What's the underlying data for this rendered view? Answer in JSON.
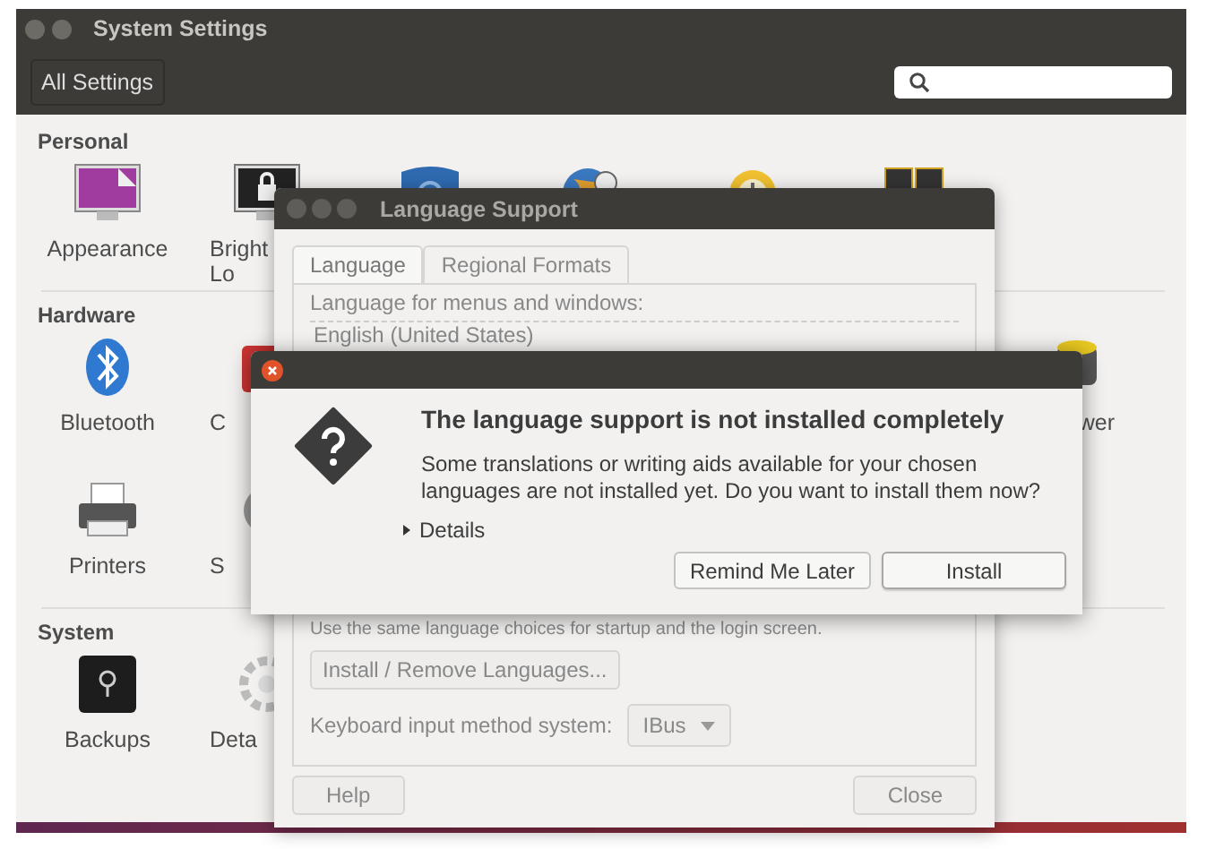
{
  "settings_window": {
    "title": "System Settings",
    "all_settings_button": "All Settings"
  },
  "sections": [
    {
      "title": "Personal",
      "items": [
        {
          "kind": "full",
          "lines": [
            "Appearance"
          ]
        },
        {
          "kind": "cut_right",
          "lines": [
            "Bright",
            "Lo"
          ]
        },
        {
          "kind": "icon_only"
        },
        {
          "kind": "icon_only"
        },
        {
          "kind": "icon_only"
        },
        {
          "kind": "icon_only"
        }
      ]
    },
    {
      "title": "Hardware",
      "items": [
        {
          "kind": "full",
          "lines": [
            "Bluetooth"
          ]
        },
        {
          "kind": "cut_right",
          "lines": [
            "C"
          ]
        },
        {
          "kind": "cut_left",
          "lines": [
            "wer"
          ]
        },
        {
          "kind": "full",
          "lines": [
            "Printers"
          ]
        },
        {
          "kind": "cut_right",
          "lines": [
            "S"
          ]
        }
      ]
    },
    {
      "title": "System",
      "items": [
        {
          "kind": "full",
          "lines": [
            "Backups"
          ]
        },
        {
          "kind": "cut_right",
          "lines": [
            "Deta"
          ]
        }
      ]
    }
  ],
  "language_support": {
    "title": "Language Support",
    "tabs": [
      {
        "label": "Language",
        "selected": true
      },
      {
        "label": "Regional Formats",
        "selected": false
      }
    ],
    "list_label": "Language for menus and windows:",
    "languages": [
      "English (United States)"
    ],
    "note": "Use the same language choices for startup and the login screen.",
    "install_button": "Install / Remove Languages...",
    "keyboard_label": "Keyboard input method system:",
    "keyboard_method": "IBus",
    "buttons": [
      "Help",
      "Close"
    ]
  },
  "dialog": {
    "heading": "The language support is not installed completely",
    "message_lines": [
      "Some translations or writing aids available for your chosen",
      "languages are not installed yet. Do you want to install them now?"
    ],
    "details": {
      "label": "Details",
      "expanded": false
    },
    "buttons": [
      {
        "label": "Remind Me Later",
        "default": false
      },
      {
        "label": "Install",
        "default": true
      }
    ]
  }
}
